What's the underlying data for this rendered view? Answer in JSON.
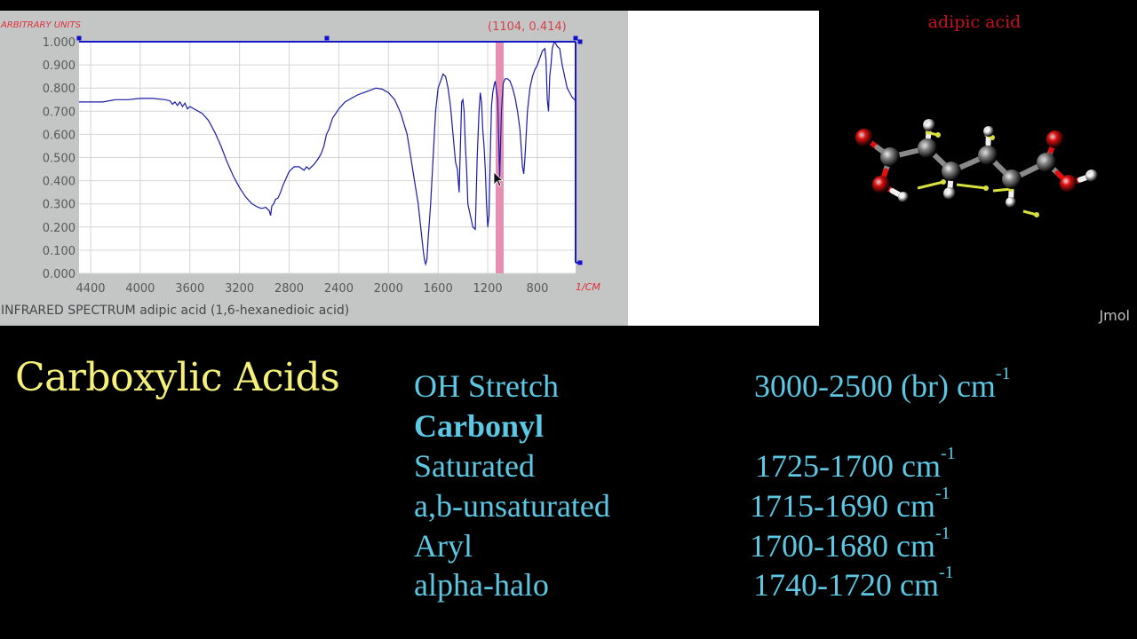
{
  "chart_data": {
    "type": "line",
    "title": "INFRARED SPECTRUM adipic acid (1,6-hexanedioic acid)",
    "xlabel": "1/CM",
    "ylabel": "ARBITRARY UNITS",
    "xlim": [
      4493,
      492
    ],
    "ylim": [
      0,
      1
    ],
    "x_reversed": true,
    "grid": true,
    "x_ticks": [
      4400,
      4000,
      3600,
      3200,
      2800,
      2400,
      2000,
      1600,
      1200,
      800
    ],
    "x_tick_labels": [
      "4400",
      "4000",
      "3600",
      "3200",
      "2800",
      "2400",
      "2000",
      "1600",
      "1200",
      "800"
    ],
    "y_ticks": [
      0,
      0.1,
      0.2,
      0.3,
      0.4,
      0.5,
      0.6,
      0.7,
      0.8,
      0.9,
      1.0
    ],
    "y_tick_labels": [
      "0.000",
      "0.100",
      "0.200",
      "0.300",
      "0.400",
      "0.500",
      "0.600",
      "0.700",
      "0.800",
      "0.900",
      "1.000"
    ],
    "series": [
      {
        "name": "adipic acid IR spectrum",
        "color": "#1a1aa8",
        "x": [
          4493,
          4400,
          4300,
          4200,
          4100,
          4000,
          3900,
          3800,
          3760,
          3740,
          3720,
          3700,
          3680,
          3660,
          3640,
          3620,
          3600,
          3550,
          3500,
          3450,
          3400,
          3350,
          3300,
          3250,
          3200,
          3150,
          3100,
          3050,
          3020,
          2990,
          2960,
          2950,
          2940,
          2925,
          2910,
          2890,
          2870,
          2850,
          2800,
          2760,
          2720,
          2680,
          2660,
          2640,
          2600,
          2560,
          2540,
          2520,
          2500,
          2480,
          2450,
          2400,
          2350,
          2300,
          2250,
          2200,
          2150,
          2100,
          2050,
          2000,
          1950,
          1900,
          1850,
          1820,
          1790,
          1760,
          1740,
          1720,
          1710,
          1700,
          1690,
          1680,
          1660,
          1640,
          1620,
          1600,
          1580,
          1560,
          1540,
          1520,
          1500,
          1480,
          1460,
          1445,
          1430,
          1420,
          1410,
          1400,
          1390,
          1380,
          1370,
          1360,
          1340,
          1320,
          1300,
          1285,
          1270,
          1260,
          1250,
          1240,
          1230,
          1220,
          1210,
          1200,
          1190,
          1180,
          1170,
          1160,
          1150,
          1140,
          1120,
          1104,
          1090,
          1075,
          1060,
          1040,
          1020,
          1000,
          980,
          960,
          940,
          930,
          920,
          910,
          900,
          890,
          880,
          860,
          840,
          820,
          800,
          780,
          760,
          740,
          730,
          720,
          710,
          700,
          690,
          680,
          670,
          660,
          650,
          640,
          620,
          600,
          580,
          560,
          540,
          520,
          500,
          492
        ],
        "y": [
          0.74,
          0.74,
          0.74,
          0.75,
          0.75,
          0.755,
          0.755,
          0.75,
          0.745,
          0.73,
          0.74,
          0.725,
          0.74,
          0.72,
          0.735,
          0.71,
          0.72,
          0.705,
          0.69,
          0.66,
          0.61,
          0.55,
          0.48,
          0.42,
          0.37,
          0.33,
          0.3,
          0.285,
          0.28,
          0.285,
          0.27,
          0.25,
          0.29,
          0.3,
          0.32,
          0.325,
          0.35,
          0.38,
          0.44,
          0.46,
          0.46,
          0.445,
          0.46,
          0.45,
          0.47,
          0.5,
          0.52,
          0.55,
          0.6,
          0.62,
          0.67,
          0.71,
          0.74,
          0.755,
          0.77,
          0.78,
          0.79,
          0.8,
          0.795,
          0.78,
          0.75,
          0.69,
          0.6,
          0.5,
          0.4,
          0.3,
          0.2,
          0.1,
          0.06,
          0.04,
          0.06,
          0.15,
          0.3,
          0.5,
          0.7,
          0.8,
          0.83,
          0.86,
          0.85,
          0.8,
          0.72,
          0.6,
          0.48,
          0.45,
          0.35,
          0.55,
          0.74,
          0.75,
          0.7,
          0.55,
          0.45,
          0.3,
          0.25,
          0.2,
          0.19,
          0.5,
          0.7,
          0.78,
          0.74,
          0.62,
          0.55,
          0.45,
          0.3,
          0.2,
          0.25,
          0.5,
          0.72,
          0.78,
          0.81,
          0.83,
          0.75,
          0.414,
          0.7,
          0.82,
          0.84,
          0.84,
          0.83,
          0.8,
          0.76,
          0.7,
          0.62,
          0.54,
          0.46,
          0.43,
          0.5,
          0.6,
          0.7,
          0.8,
          0.85,
          0.88,
          0.9,
          0.93,
          0.96,
          0.97,
          0.92,
          0.75,
          0.7,
          0.85,
          0.9,
          0.97,
          0.99,
          1.0,
          0.99,
          0.98,
          0.97,
          0.9,
          0.85,
          0.8,
          0.78,
          0.76,
          0.75,
          0.74
        ]
      }
    ],
    "cursor": {
      "x": 1104,
      "y": 0.414,
      "label": "(1104, 0.414)"
    }
  },
  "spectrum_panel": {
    "units_label": "ARBITRARY UNITS",
    "x_unit_label": "1/CM",
    "cursor_readout": "(1104, 0.414)",
    "caption": "INFRARED SPECTRUM adipic acid (1,6-hexanedioic acid)",
    "colors": {
      "trace": "#1a1aa8",
      "cursor_band": "#e78fb3",
      "grid": "#d4d6d5",
      "label_red": "#e0303a"
    }
  },
  "jmol": {
    "molecule_name": "adipic acid",
    "logo": "Jmol",
    "atom_colors": {
      "carbon": "#8a8a8a",
      "oxygen": "#e01010",
      "hydrogen": "#f0f0f0",
      "vibration_vector": "#d8e040"
    }
  },
  "slide": {
    "title": "Carboxylic Acids",
    "rows": [
      {
        "label": "OH Stretch",
        "value": "3000-2500 (br) cm",
        "sup": "-1",
        "bold": false
      },
      {
        "label": "Carbonyl",
        "value": "",
        "sup": "",
        "bold": true
      },
      {
        "label": "Saturated",
        "value": "1725-1700 cm",
        "sup": "-1",
        "bold": false
      },
      {
        "label": "a,b-unsaturated",
        "value": "1715-1690 cm",
        "sup": "-1",
        "bold": false
      },
      {
        "label": "Aryl",
        "value": "1700-1680 cm",
        "sup": "-1",
        "bold": false
      },
      {
        "label": "alpha-halo",
        "value": "1740-1720 cm",
        "sup": "-1",
        "bold": false
      }
    ]
  }
}
